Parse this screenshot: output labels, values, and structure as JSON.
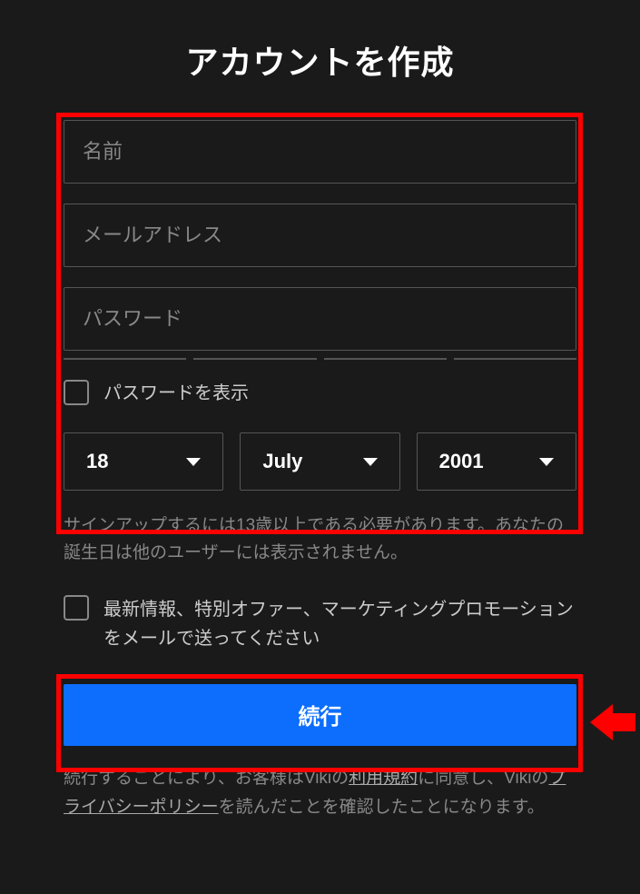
{
  "title": "アカウントを作成",
  "form": {
    "name_placeholder": "名前",
    "email_placeholder": "メールアドレス",
    "password_placeholder": "パスワード",
    "show_password_label": "パスワードを表示",
    "date": {
      "day": "18",
      "month": "July",
      "year": "2001"
    },
    "age_note": "サインアップするには13歳以上である必要があります。あなたの誕生日は他のユーザーには表示されません。",
    "newsletter_label": "最新情報、特別オファー、マーケティングプロモーションをメールで送ってください",
    "continue_label": "続行",
    "terms_prefix": "続行することにより、お客様はVikiの",
    "terms_link1": "利用規約",
    "terms_mid": "に同意し、Vikiの",
    "terms_link2": "プライバシーポリシー",
    "terms_suffix": "を読んだことを確認したことになります。"
  }
}
